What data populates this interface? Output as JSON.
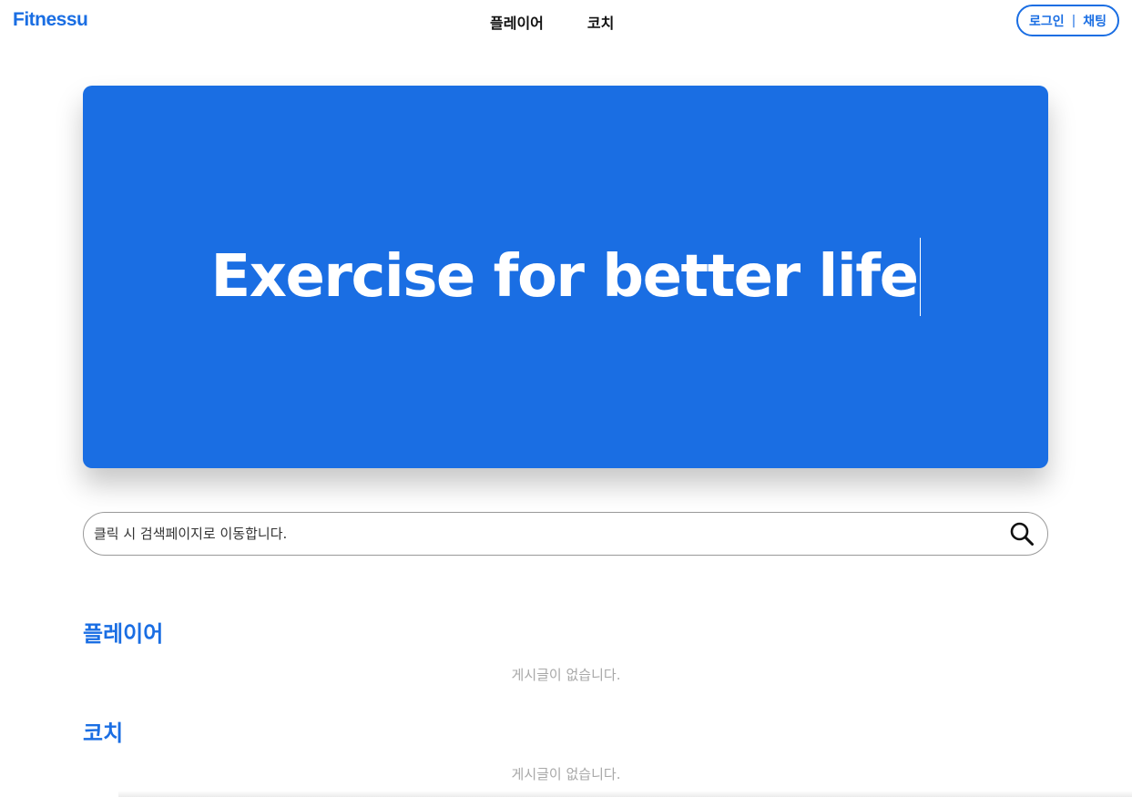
{
  "header": {
    "logo": "Fitnessu",
    "nav": [
      {
        "label": "플레이어"
      },
      {
        "label": "코치"
      }
    ],
    "auth": {
      "login_label": "로그인",
      "separator": "|",
      "chat_label": "채팅"
    }
  },
  "hero": {
    "title": "Exercise for better life",
    "color": "#1a6ee3"
  },
  "search": {
    "placeholder": "클릭 시 검색페이지로 이동합니다.",
    "value": "",
    "icon": "search-icon"
  },
  "sections": [
    {
      "title": "플레이어",
      "empty_text": "게시글이 없습니다."
    },
    {
      "title": "코치",
      "empty_text": "게시글이 없습니다."
    }
  ]
}
